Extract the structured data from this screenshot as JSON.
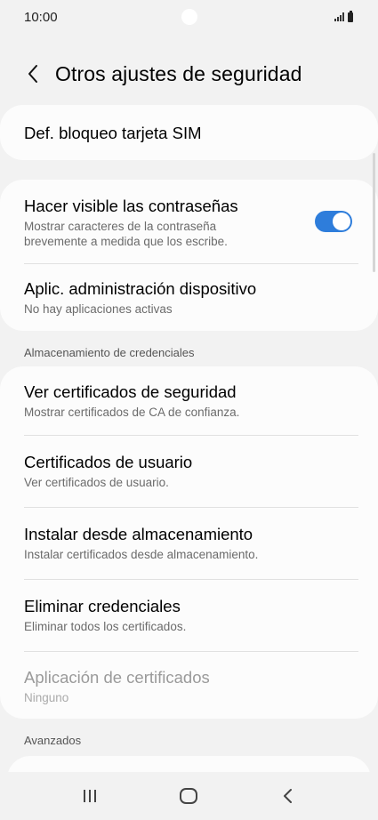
{
  "status": {
    "time": "10:00"
  },
  "header": {
    "title": "Otros ajustes de seguridad"
  },
  "sim_card": {
    "title": "Def. bloqueo tarjeta SIM"
  },
  "visibility_card": {
    "show_passwords": {
      "title": "Hacer visible las contraseñas",
      "subtitle_line1": "Mostrar caracteres de la contraseña",
      "subtitle_line2": "brevemente a medida que los escribe.",
      "enabled": true
    },
    "device_admin": {
      "title": "Aplic. administración dispositivo",
      "subtitle": "No hay aplicaciones activas"
    }
  },
  "credentials_section": {
    "label": "Almacenamiento de credenciales",
    "items": [
      {
        "title": "Ver certificados de seguridad",
        "subtitle": "Mostrar certificados de CA de confianza."
      },
      {
        "title": "Certificados de usuario",
        "subtitle": "Ver certificados de usuario."
      },
      {
        "title": "Instalar desde almacenamiento",
        "subtitle": "Instalar certificados desde almacenamiento."
      },
      {
        "title": "Eliminar credenciales",
        "subtitle": "Eliminar todos los certificados."
      },
      {
        "title": "Aplicación de certificados",
        "subtitle": "Ninguno",
        "disabled": true
      }
    ]
  },
  "advanced_section": {
    "label": "Avanzados"
  },
  "colors": {
    "toggle_on": "#2e7ddb",
    "background": "#f2f2f2",
    "card": "#fcfcfc"
  },
  "icons": {
    "back": "back-arrow-icon",
    "recents": "recents-icon",
    "home": "home-icon",
    "nav_back": "nav-back-icon"
  }
}
